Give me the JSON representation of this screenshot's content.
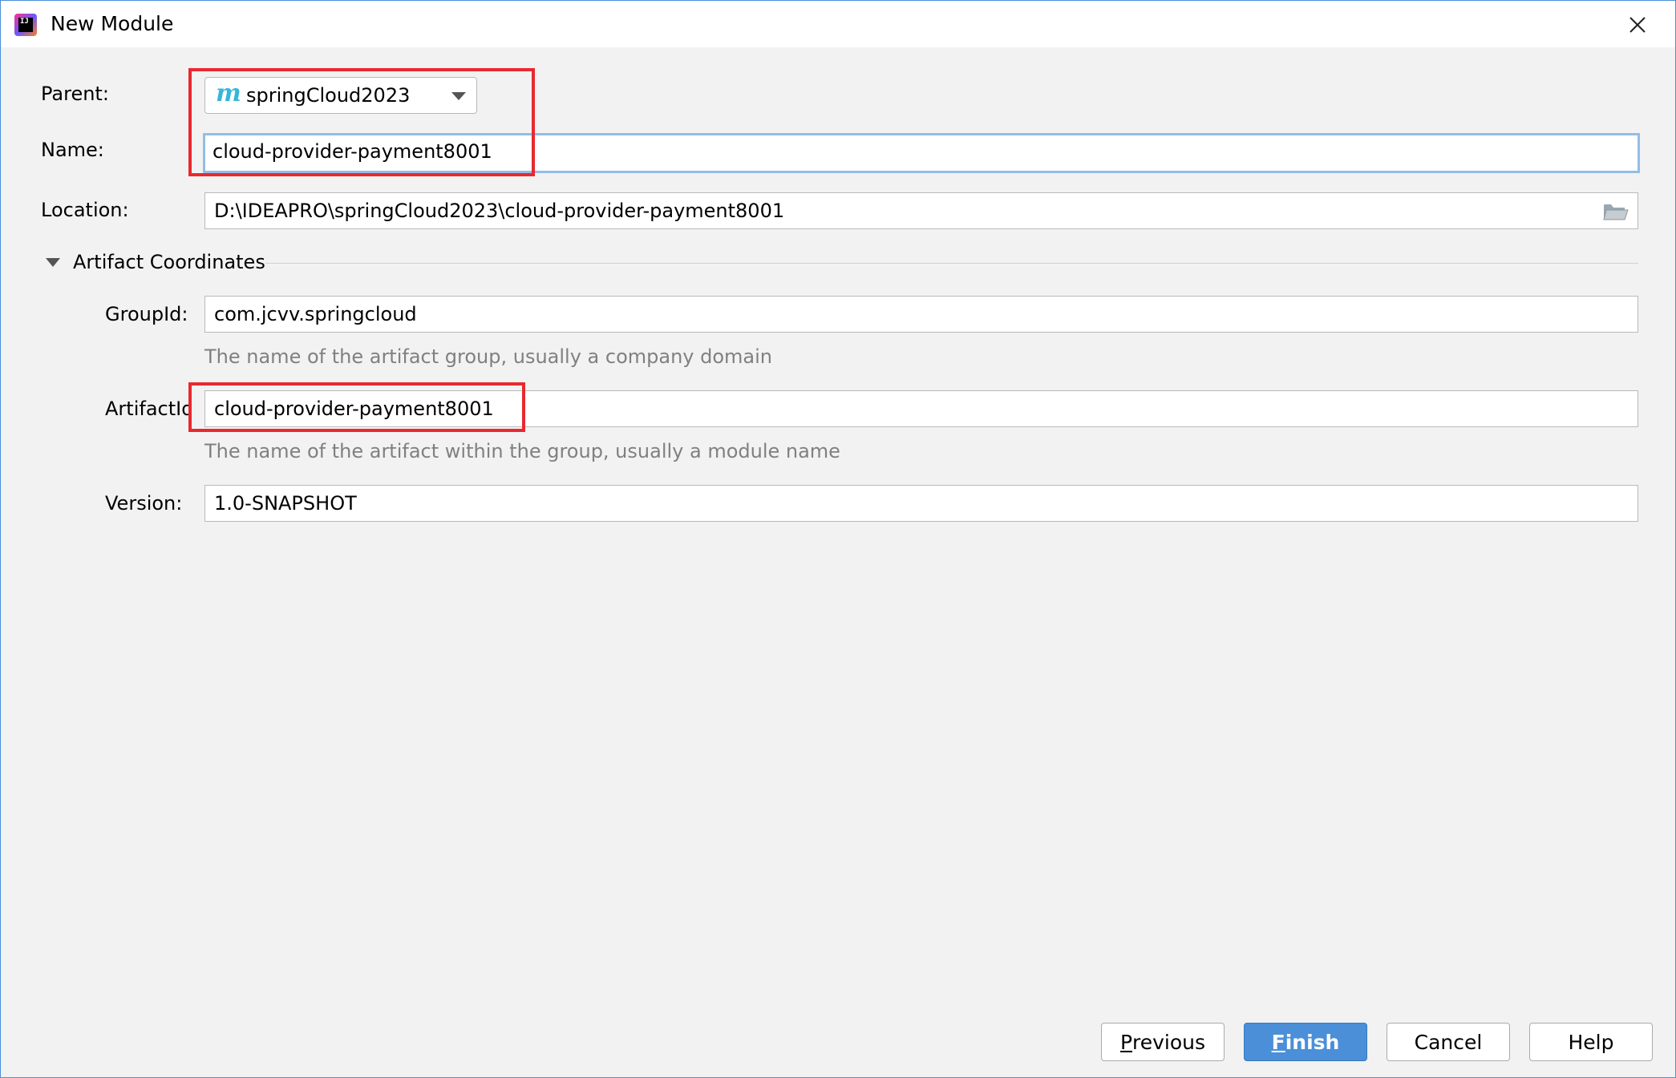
{
  "window": {
    "title": "New Module",
    "app_icon_text": "IJ"
  },
  "form": {
    "parent_label": "Parent:",
    "parent_value": "springCloud2023",
    "parent_icon_glyph": "m",
    "name_label": "Name:",
    "name_value": "cloud-provider-payment8001",
    "location_label": "Location:",
    "location_value": "D:\\IDEAPRO\\springCloud2023\\cloud-provider-payment8001"
  },
  "artifact": {
    "section_title": "Artifact Coordinates",
    "expanded": true,
    "group_label": "GroupId:",
    "group_value": "com.jcvv.springcloud",
    "group_hint": "The name of the artifact group, usually a company domain",
    "artifact_label": "ArtifactId:",
    "artifact_value": "cloud-provider-payment8001",
    "artifact_hint": "The name of the artifact within the group, usually a module name",
    "version_label": "Version:",
    "version_value": "1.0-SNAPSHOT"
  },
  "buttons": {
    "previous_mnemonic": "P",
    "previous_rest": "revious",
    "finish_mnemonic": "F",
    "finish_rest": "inish",
    "cancel": "Cancel",
    "help": "Help"
  },
  "colors": {
    "accent": "#4a8fd8",
    "highlight_annotation": "#e8292f",
    "focus_border": "#93bde8",
    "maven_icon": "#36b6da"
  },
  "icons": {
    "close": "close-icon",
    "folder": "folder-open-icon",
    "maven": "maven-icon",
    "dropdown": "chevron-down-icon",
    "section_toggle": "triangle-down-icon"
  }
}
